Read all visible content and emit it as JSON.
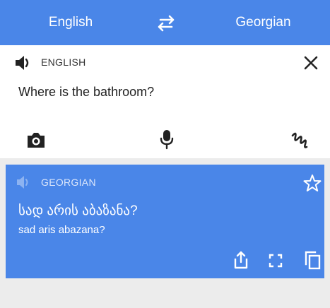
{
  "header": {
    "source_language": "English",
    "target_language": "Georgian",
    "swap_icon": "swap-arrows-icon"
  },
  "input": {
    "language_label": "ENGLISH",
    "text": "Where is the bathroom?",
    "icons": [
      "speaker-icon",
      "close-icon",
      "camera-icon",
      "microphone-icon",
      "handwriting-icon"
    ]
  },
  "result": {
    "language_label": "GEORGIAN",
    "translation": "სად არის აბაზანა?",
    "transliteration": "sad aris abazana?",
    "icons": [
      "speaker-icon",
      "star-icon",
      "share-icon",
      "fullscreen-icon",
      "copy-icon"
    ]
  },
  "colors": {
    "accent": "#4a86e8",
    "card": "#ffffff",
    "background": "#ececec"
  }
}
